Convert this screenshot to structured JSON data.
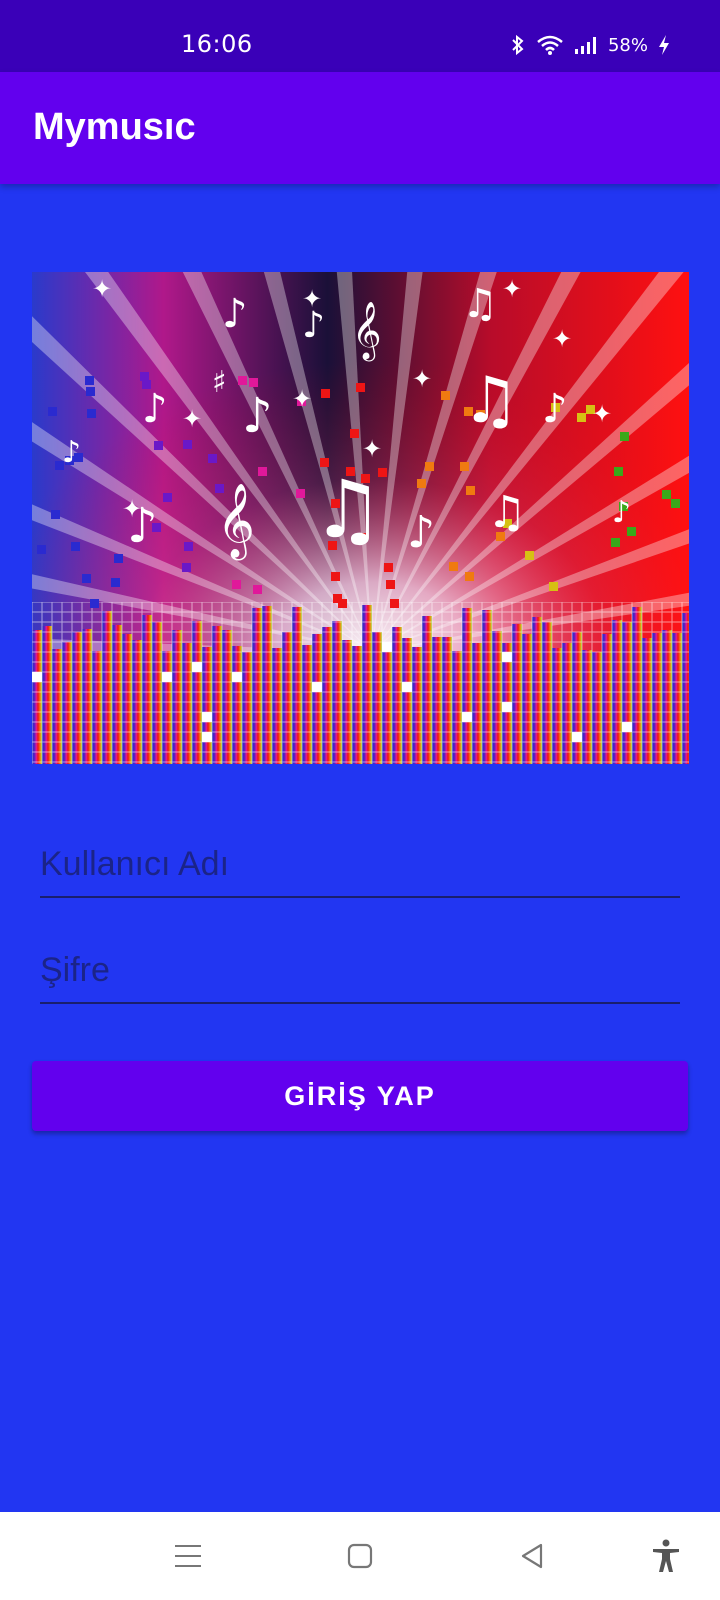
{
  "status_bar": {
    "time": "16:06",
    "battery": "58%",
    "icons": [
      "bluetooth-icon",
      "wifi-icon",
      "signal-icon",
      "battery-charging-icon"
    ]
  },
  "app_bar": {
    "title": "Mymusıc"
  },
  "banner": {
    "icon": "music-equalizer-banner"
  },
  "form": {
    "username_placeholder": "Kullanıcı Adı",
    "username_value": "",
    "password_placeholder": "Şifre",
    "password_value": "",
    "login_label": "GİRİŞ YAP"
  },
  "nav_bar": {
    "icons": [
      "menu-icon",
      "home-icon",
      "back-icon",
      "accessibility-icon"
    ]
  },
  "colors": {
    "background": "#2236f2",
    "app_bar": "#6200ee",
    "status_bar": "#3a00b8",
    "button": "#6200ee"
  }
}
